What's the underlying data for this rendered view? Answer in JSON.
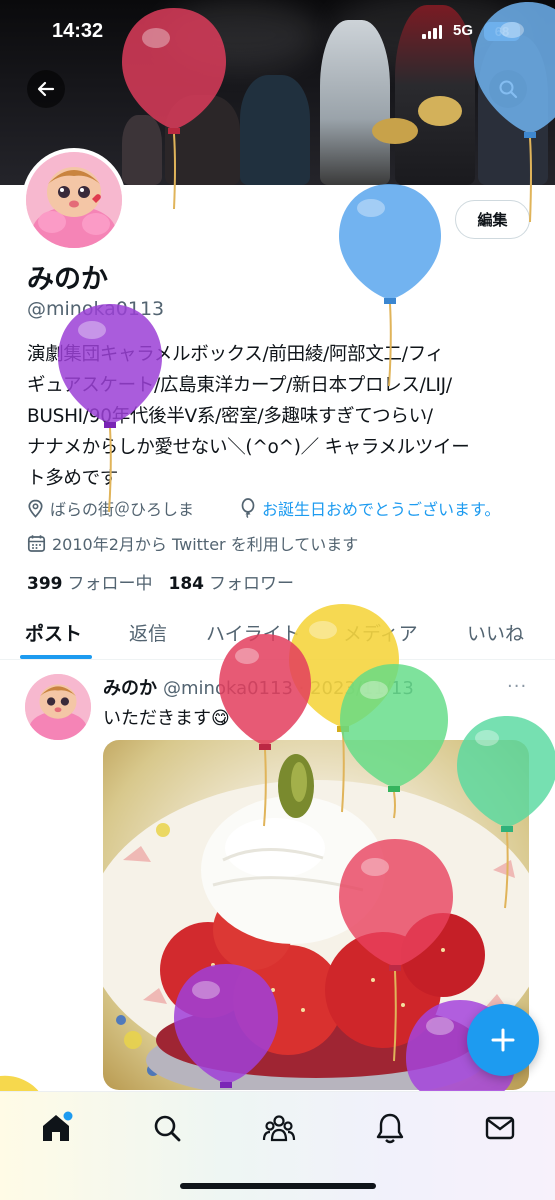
{
  "status_bar": {
    "time": "14:32",
    "network": "5G",
    "battery": "68"
  },
  "profile": {
    "display_name": "みのか",
    "handle": "@minoka0113",
    "edit_label": "編集",
    "bio_lines": [
      "演劇集団キャラメルボックス/前田綾/阿部文二/フィ",
      "ギュアスケート/広島東洋カープ/新日本プロレス/LIJ/",
      "BUSHI/90年代後半V系/密室/多趣味すぎてつらい/",
      "ナナメからしか愛せない＼(^o^)／ キャラメルツイー",
      "ト多めです"
    ],
    "location": "ばらの街＠ひろしま",
    "birthday": "お誕生日おめでとうございます。",
    "joined": "2010年2月から Twitter を利用しています",
    "following_count": "399",
    "following_label": "フォロー中",
    "followers_count": "184",
    "followers_label": "フォロワー"
  },
  "tabs": [
    {
      "label": "ポスト",
      "active": true
    },
    {
      "label": "返信",
      "active": false
    },
    {
      "label": "ハイライト",
      "active": false
    },
    {
      "label": "メディア",
      "active": false
    },
    {
      "label": "いいね",
      "active": false
    }
  ],
  "post": {
    "name": "みのか",
    "handle_date": "@minoka0113 · 2023/11/13",
    "text": "いただきます😋",
    "more": "···"
  },
  "icons": {
    "back": "arrow-left-icon",
    "search": "search-icon",
    "location": "location-pin-icon",
    "birthday": "balloon-icon",
    "joined": "calendar-icon",
    "compose": "plus-icon",
    "nav": [
      "home-icon",
      "search-icon",
      "communities-icon",
      "notifications-icon",
      "messages-icon"
    ]
  },
  "colors": {
    "accent": "#1d9bf0",
    "text": "#0f1419",
    "secondary": "#536471"
  }
}
